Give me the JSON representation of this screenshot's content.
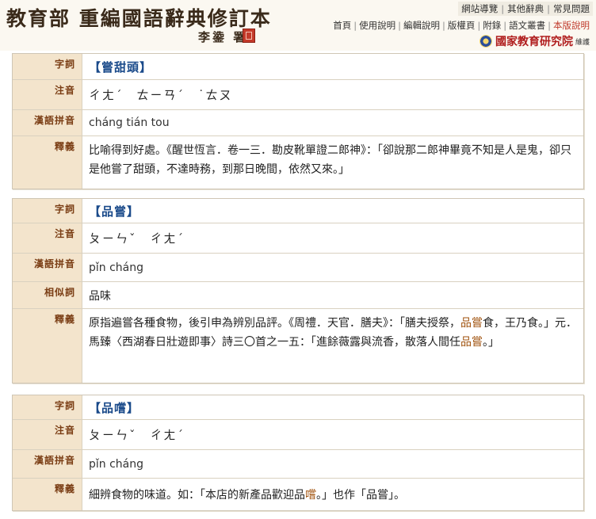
{
  "header": {
    "title": "教育部 重編國語辭典修訂本",
    "subtitle": "李鍌 署",
    "top_links": [
      "網站導覽",
      "其他辭典",
      "常見問題"
    ],
    "nav_links": [
      "首頁",
      "使用說明",
      "編輯說明",
      "版權頁",
      "附錄",
      "語文叢書",
      "本版說明"
    ],
    "institute": "國家教育研究院",
    "institute_note": "維護"
  },
  "entries": [
    {
      "labels": {
        "word": "字詞",
        "zhuyin": "注音",
        "pinyin": "漢語拼音",
        "def": "釋義"
      },
      "word": "【嘗甜頭】",
      "zhuyin": "ㄔㄤˊ　ㄊㄧㄢˊ　˙ㄊㄡ",
      "pinyin": "cháng tián tou",
      "def": "比喻得到好處。《醒世恆言．卷一三．勘皮靴單證二郎神》：「卻說那二郎神畢竟不知是人是鬼，卻只是他嘗了甜頭，不達時務，到那日晚間，依然又來。」"
    },
    {
      "labels": {
        "word": "字詞",
        "zhuyin": "注音",
        "pinyin": "漢語拼音",
        "related": "相似詞",
        "def": "釋義"
      },
      "word": "【品嘗】",
      "zhuyin": "ㄆㄧㄣˇ　ㄔㄤˊ",
      "pinyin": "pǐn cháng",
      "related": "品味",
      "def_a": "原指遍嘗各種食物，後引申為辨別品評。《周禮．天官．膳夫》：「膳夫授祭，",
      "def_hl": "品嘗",
      "def_b": "食，王乃食。」元．馬臻〈西湖春日壯遊即事〉詩三〇首之一五：「進餘薇露與流香，散落人間任",
      "def_hl2": "品嘗",
      "def_c": "。」"
    },
    {
      "labels": {
        "word": "字詞",
        "zhuyin": "注音",
        "pinyin": "漢語拼音",
        "def": "釋義"
      },
      "word": "【品嚐】",
      "zhuyin": "ㄆㄧㄣˇ　ㄔㄤˊ",
      "pinyin": "pǐn cháng",
      "def_a": "細辨食物的味道。如：「本店的新產品歡迎品",
      "def_hl": "嚐",
      "def_b": "。」也作「品嘗」。"
    }
  ]
}
